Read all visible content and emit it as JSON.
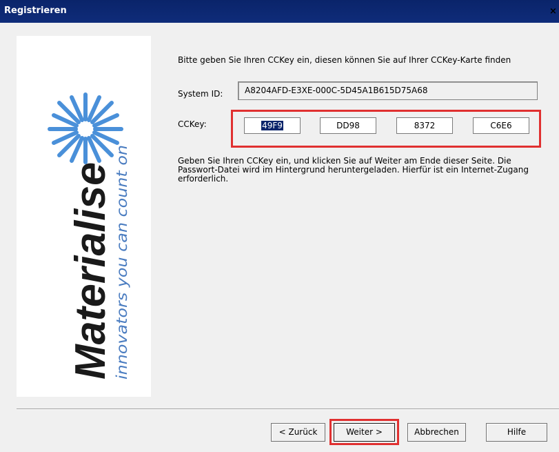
{
  "window": {
    "title": "Registrieren",
    "close_glyph": "×"
  },
  "logo": {
    "brand": "Materialise",
    "tagline": "innovators you can count on",
    "brand_color": "#1a1a1a",
    "tagline_color": "#4a7cc0",
    "burst_color": "#4a90d9"
  },
  "form": {
    "instruction": "Bitte geben Sie Ihren CCKey ein, diesen können Sie auf Ihrer CCKey-Karte finden",
    "system_id_label": "System ID:",
    "system_id_value": "A8204AFD-E3XE-000C-5D45A1B615D75A68",
    "cckey_label": "CCKey:",
    "cckey_parts": [
      "49F9",
      "DD98",
      "8372",
      "C6E6"
    ],
    "info": "Geben Sie Ihren CCKey ein, und klicken Sie auf Weiter am Ende dieser Seite. Die Passwort-Datei wird im Hintergrund heruntergeladen. Hierfür ist ein Internet-Zugang erforderlich."
  },
  "buttons": {
    "back": "< Zurück",
    "next": "Weiter >",
    "cancel": "Abbrechen",
    "help": "Hilfe"
  },
  "highlight_color": "#e03030"
}
